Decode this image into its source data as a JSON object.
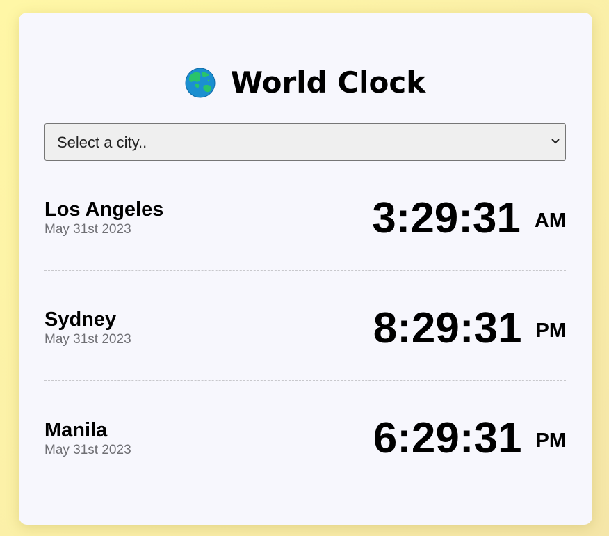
{
  "app": {
    "title": "World Clock",
    "globe_icon": "globe-asia-australia-icon"
  },
  "city_select": {
    "selected_label": "Select a city..",
    "chevron_icon": "chevron-down-icon"
  },
  "cities": [
    {
      "name": "Los Angeles",
      "date": "May 31st 2023",
      "time": "3:29:31",
      "ampm": "AM"
    },
    {
      "name": "Sydney",
      "date": "May 31st 2023",
      "time": "8:29:31",
      "ampm": "PM"
    },
    {
      "name": "Manila",
      "date": "May 31st 2023",
      "time": "6:29:31",
      "ampm": "PM"
    }
  ],
  "colors": {
    "background": "#fff7a6",
    "card": "#f7f7fd",
    "date_text": "#6f6f74"
  }
}
